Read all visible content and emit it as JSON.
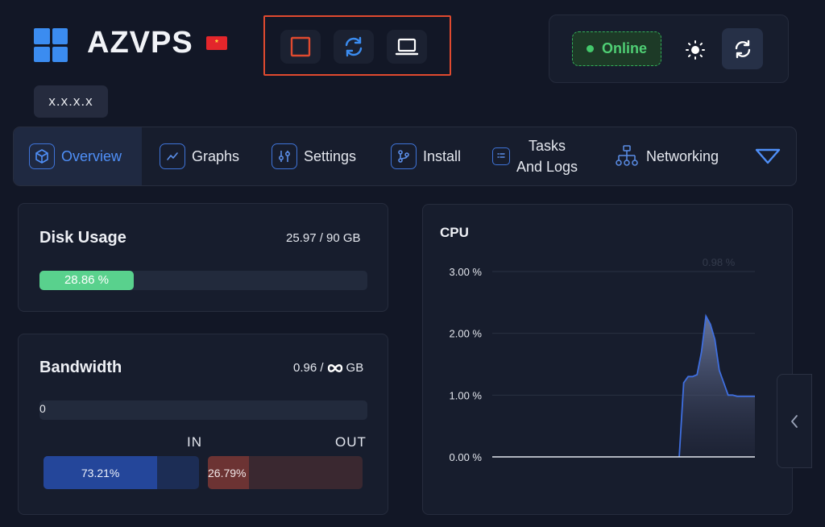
{
  "app": {
    "title": "AZVPS",
    "flag_symbol": "*",
    "ip": "x.x.x.x"
  },
  "power_actions": [
    {
      "name": "stop",
      "icon": "stop-square-icon",
      "color": "#e04a2f"
    },
    {
      "name": "restart",
      "icon": "restart-icon",
      "color": "#3b8cf0"
    },
    {
      "name": "console",
      "icon": "laptop-icon",
      "color": "#ffffff"
    }
  ],
  "status": {
    "label": "Online",
    "color": "#4fce74",
    "theme_icon": "sun-icon",
    "refresh_icon": "refresh-icon"
  },
  "tabs": [
    {
      "label": "Overview",
      "icon": "cube-icon",
      "active": true
    },
    {
      "label": "Graphs",
      "icon": "trend-line-icon"
    },
    {
      "label": "Settings",
      "icon": "sliders-icon"
    },
    {
      "label": "Install",
      "icon": "git-branch-icon"
    },
    {
      "label_line1": "Tasks",
      "label_line2": "And Logs",
      "icon": "task-list-icon"
    },
    {
      "label": "Networking",
      "icon": "network-icon"
    }
  ],
  "disk": {
    "title": "Disk Usage",
    "stat": "25.97 / 90 GB",
    "percent_label": "28.86 %",
    "percent": 28.86
  },
  "bandwidth": {
    "title": "Bandwidth",
    "stat_value": "0.96 /",
    "stat_unit": "GB",
    "bar_value": "0",
    "in_label": "IN",
    "out_label": "OUT",
    "in_percent_label": "73.21%",
    "out_percent_label": "26.79%",
    "in_percent": 73.21,
    "out_percent": 26.79
  },
  "chart_data": {
    "type": "area",
    "title": "CPU",
    "xlabel": "",
    "ylabel": "",
    "ylim": [
      0,
      3
    ],
    "yticks": [
      "3.00 %",
      "2.00 %",
      "1.00 %",
      "0.00 %"
    ],
    "ytick_values": [
      3,
      2,
      1,
      0
    ],
    "annotation": "0.98 %",
    "grid": true,
    "x": [
      0,
      1,
      2,
      3,
      4,
      5,
      6,
      7,
      8,
      9,
      10,
      11,
      12,
      13,
      14,
      15,
      16,
      17,
      18,
      19,
      20,
      21,
      22,
      23,
      24,
      25,
      26,
      27,
      28,
      29,
      30,
      31,
      32,
      33,
      34,
      35,
      36,
      37,
      38,
      39,
      40,
      41,
      42,
      43,
      44,
      45,
      46,
      47,
      48,
      49,
      50,
      51,
      52,
      53,
      54,
      55,
      56,
      57,
      58,
      59
    ],
    "values": [
      0,
      0,
      0,
      0,
      0,
      0,
      0,
      0,
      0,
      0,
      0,
      0,
      0,
      0,
      0,
      0,
      0,
      0,
      0,
      0,
      0,
      0,
      0,
      0,
      0,
      0,
      0,
      0,
      0,
      0,
      0,
      0,
      0,
      0,
      0,
      0,
      0,
      0,
      0,
      0,
      0,
      0,
      0,
      1.2,
      1.3,
      1.3,
      1.33,
      1.7,
      2.28,
      2.15,
      1.9,
      1.4,
      1.2,
      1.0,
      1.0,
      0.98,
      0.98,
      0.98,
      0.98,
      0.98
    ],
    "line_color": "#3f6fe0"
  }
}
